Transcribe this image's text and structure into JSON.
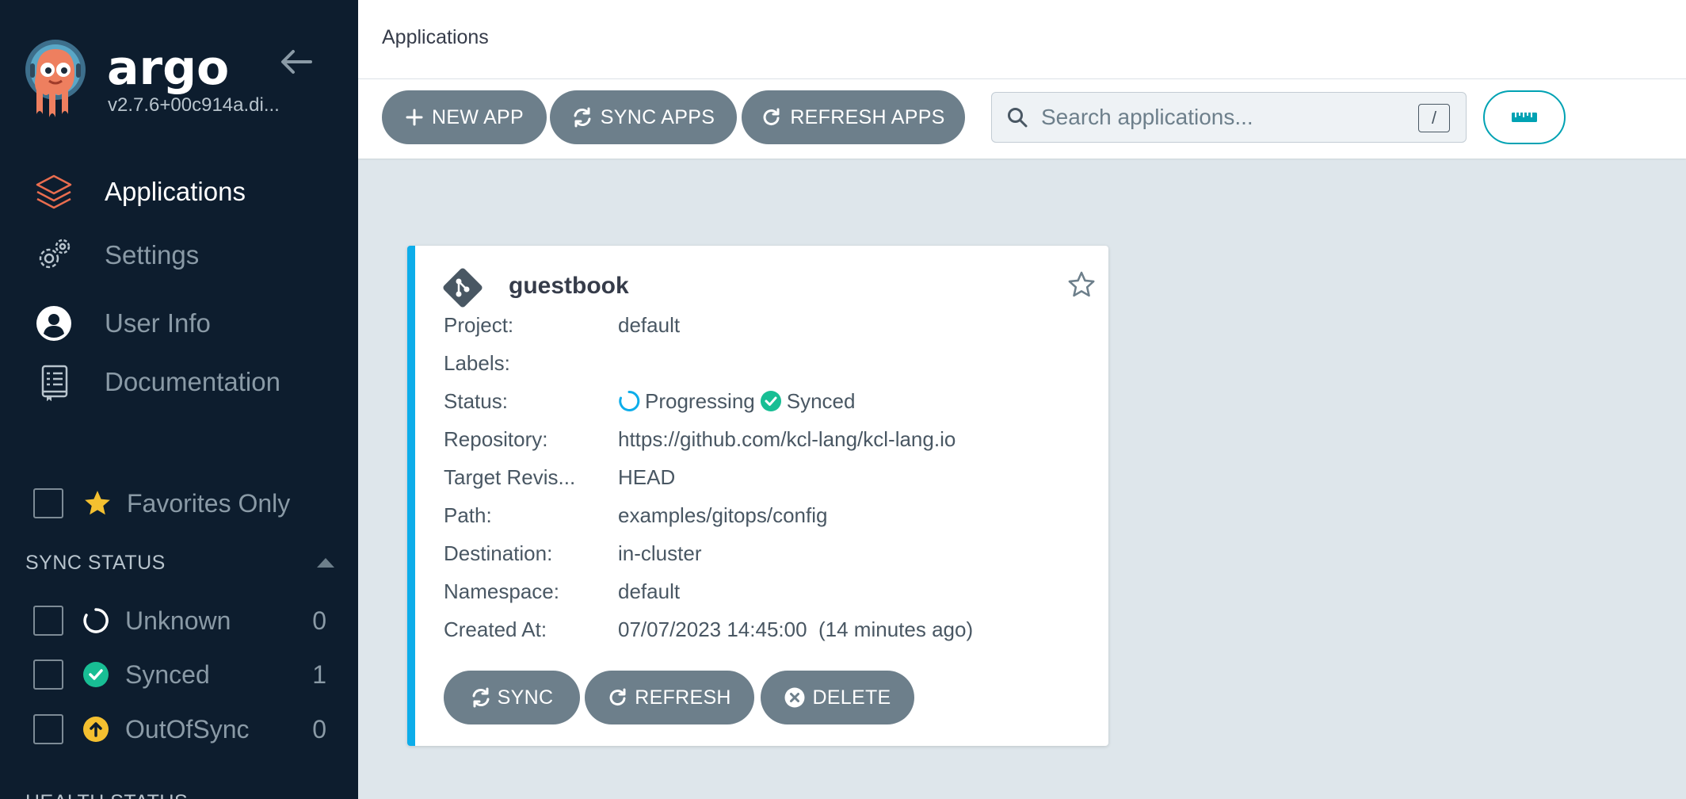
{
  "sidebar": {
    "brand": "argo",
    "version": "v2.7.6+00c914a.di...",
    "nav": [
      {
        "label": "Applications",
        "icon": "layers-icon",
        "active": true
      },
      {
        "label": "Settings",
        "icon": "gears-icon",
        "active": false
      },
      {
        "label": "User Info",
        "icon": "user-circle-icon",
        "active": false
      },
      {
        "label": "Documentation",
        "icon": "book-icon",
        "active": false
      }
    ],
    "favorites_label": "Favorites Only",
    "sync_status_title": "SYNC STATUS",
    "sync_filters": [
      {
        "label": "Unknown",
        "count": "0",
        "icon": "circle-notch-icon"
      },
      {
        "label": "Synced",
        "count": "1",
        "icon": "check-circle-icon"
      },
      {
        "label": "OutOfSync",
        "count": "0",
        "icon": "arrow-up-circle-icon"
      }
    ],
    "health_status_title": "HEALTH STATUS"
  },
  "header": {
    "title": "Applications"
  },
  "toolbar": {
    "new_app": "NEW APP",
    "sync_apps": "SYNC APPS",
    "refresh_apps": "REFRESH APPS",
    "search_placeholder": "Search applications...",
    "search_value": "",
    "search_shortcut": "/"
  },
  "app_card": {
    "name": "guestbook",
    "fields": [
      {
        "label": "Project:",
        "value": "default"
      },
      {
        "label": "Labels:",
        "value": ""
      },
      {
        "label": "Status:",
        "value": ""
      },
      {
        "label": "Repository:",
        "value": "https://github.com/kcl-lang/kcl-lang.io"
      },
      {
        "label": "Target Revis...",
        "value": "HEAD"
      },
      {
        "label": "Path:",
        "value": "examples/gitops/config"
      },
      {
        "label": "Destination:",
        "value": "in-cluster"
      },
      {
        "label": "Namespace:",
        "value": "default"
      },
      {
        "label": "Created At:",
        "value": "07/07/2023 14:45:00  (14 minutes ago)"
      }
    ],
    "health_status": "Progressing",
    "sync_status": "Synced",
    "buttons": {
      "sync": "SYNC",
      "refresh": "REFRESH",
      "delete": "DELETE"
    }
  },
  "colors": {
    "sidebar_bg": "#0d1d2e",
    "accent_teal": "#00a2b3",
    "synced_green": "#18be94",
    "progressing_blue": "#0dadea",
    "outofsync_yellow": "#f4c030",
    "button_gray": "#6d7f8b",
    "layers_orange": "#e96d4f"
  }
}
